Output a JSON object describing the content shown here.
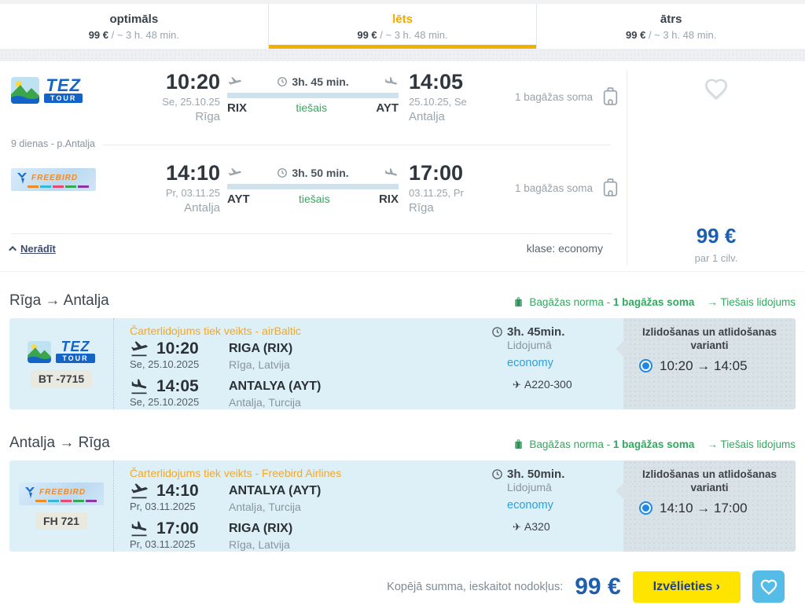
{
  "tabs": [
    {
      "label": "optimāls",
      "price": "99 €",
      "price_suffix": " / ~ 3 h. 48 min."
    },
    {
      "label": "lēts",
      "price": "99 €",
      "price_suffix": " / ~ 3 h. 48 min."
    },
    {
      "label": "ātrs",
      "price": "99 €",
      "price_suffix": " / ~ 3 h. 48 min."
    }
  ],
  "logos": {
    "tez_top": "TEZ",
    "tez_bottom": "TOUR",
    "freebird": "FREEBIRD"
  },
  "summary": {
    "outbound": {
      "dep_time": "10:20",
      "dep_date": "Se, 25.10.25",
      "dep_city": "Rīga",
      "dep_code": "RIX",
      "duration": "3h. 45 min.",
      "direct": "tiešais",
      "arr_code": "AYT",
      "arr_time": "14:05",
      "arr_date": "25.10.25, Se",
      "arr_city": "Antalja",
      "baggage": "1 bagāžas soma"
    },
    "stay_note": "9 dienas - p.Antalja",
    "inbound": {
      "dep_time": "14:10",
      "dep_date": "Pr, 03.11.25",
      "dep_city": "Antalja",
      "dep_code": "AYT",
      "duration": "3h. 50 min.",
      "direct": "tiešais",
      "arr_code": "RIX",
      "arr_time": "17:00",
      "arr_date": "03.11.25, Pr",
      "arr_city": "Rīga",
      "baggage": "1 bagāžas soma"
    },
    "class_label": "klase: economy",
    "hide_label": "Nerādīt",
    "price": "99 €",
    "per_person": "par 1 cilv."
  },
  "sections": [
    {
      "route": "Rīga → Antalja",
      "baggage_label": "Bagāžas norma - ",
      "baggage_value": "1 bagāžas soma",
      "direct_label": "→ Tiešais lidojums",
      "card": {
        "flight_no": "BT -7715",
        "charter": "Čarterlidojums tiek veikts - airBaltic",
        "dep_time": "10:20",
        "dep_airport": "RIGA (RIX)",
        "dep_date": "Se, 25.10.2025",
        "dep_city": "Rīga, Latvija",
        "arr_time": "14:05",
        "arr_airport": "ANTALYA (AYT)",
        "arr_date": "Se, 25.10.2025",
        "arr_city": "Antalja, Turcija",
        "duration": "3h. 45min.",
        "duration_label": "Lidojumā",
        "class": "economy",
        "aircraft": "A220-300",
        "options_title": "Izlidošanas un atlidošanas varianti",
        "option": "10:20 → 14:05"
      }
    },
    {
      "route": "Antalja → Rīga",
      "baggage_label": "Bagāžas norma - ",
      "baggage_value": "1 bagāžas soma",
      "direct_label": "→ Tiešais lidojums",
      "card": {
        "flight_no": "FH 721",
        "charter": "Čarterlidojums tiek veikts - Freebird Airlines",
        "dep_time": "14:10",
        "dep_airport": "ANTALYA (AYT)",
        "dep_date": "Pr, 03.11.2025",
        "dep_city": "Antalja, Turcija",
        "arr_time": "17:00",
        "arr_airport": "RIGA (RIX)",
        "arr_date": "Pr, 03.11.2025",
        "arr_city": "Rīga, Latvija",
        "duration": "3h. 50min.",
        "duration_label": "Lidojumā",
        "class": "economy",
        "aircraft": "A320",
        "options_title": "Izlidošanas un atlidošanas varianti",
        "option": "14:10 → 17:00"
      }
    }
  ],
  "footer": {
    "total_label": "Kopējā summa, ieskaitot nodokļus:",
    "total": "99 €",
    "cta": "Izvēlieties ›"
  },
  "colors": {
    "accent": "#f2b100",
    "green": "#2faa5f",
    "blue": "#1d5fae",
    "cta_yellow": "#ffe400"
  }
}
